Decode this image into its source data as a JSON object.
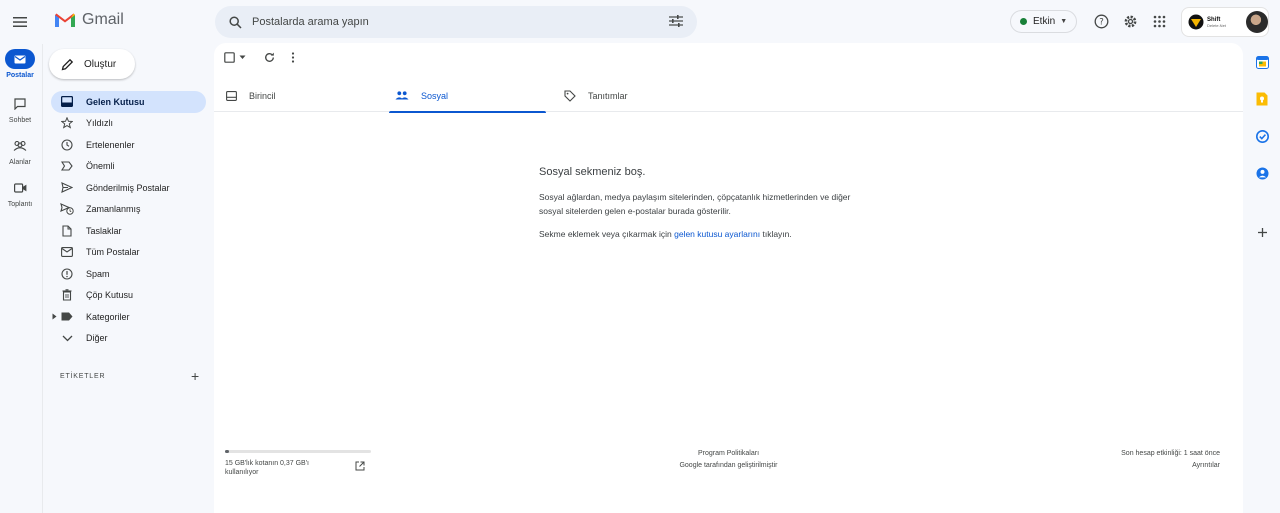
{
  "app": {
    "title": "Gmail"
  },
  "search": {
    "placeholder": "Postalarda arama yapın"
  },
  "status": {
    "label": "Etkin",
    "color": "#188038"
  },
  "account": {
    "brand_line1": "Shift",
    "brand_line2": "Delete.Net"
  },
  "rail": {
    "items": [
      {
        "label": "Postalar",
        "icon": "mail-icon",
        "active": true
      },
      {
        "label": "Sohbet",
        "icon": "chat-icon",
        "active": false
      },
      {
        "label": "Alanlar",
        "icon": "spaces-icon",
        "active": false
      },
      {
        "label": "Toplantı",
        "icon": "video-icon",
        "active": false
      }
    ]
  },
  "compose": {
    "label": "Oluştur"
  },
  "nav": {
    "items": [
      {
        "label": "Gelen Kutusu",
        "icon": "inbox-icon",
        "active": true
      },
      {
        "label": "Yıldızlı",
        "icon": "star-icon"
      },
      {
        "label": "Ertelenenler",
        "icon": "clock-icon"
      },
      {
        "label": "Önemli",
        "icon": "important-icon"
      },
      {
        "label": "Gönderilmiş Postalar",
        "icon": "send-icon"
      },
      {
        "label": "Zamanlanmış",
        "icon": "scheduled-icon"
      },
      {
        "label": "Taslaklar",
        "icon": "draft-icon"
      },
      {
        "label": "Tüm Postalar",
        "icon": "all-mail-icon"
      },
      {
        "label": "Spam",
        "icon": "spam-icon"
      },
      {
        "label": "Çöp Kutusu",
        "icon": "trash-icon"
      },
      {
        "label": "Kategoriler",
        "icon": "label-icon"
      },
      {
        "label": "Diğer",
        "icon": "chevron-down-icon"
      }
    ],
    "labels_heading": "ETİKETLER"
  },
  "tabs": [
    {
      "label": "Birincil",
      "icon": "inbox-tab-icon",
      "active": false
    },
    {
      "label": "Sosyal",
      "icon": "people-icon",
      "active": true
    },
    {
      "label": "Tanıtımlar",
      "icon": "tag-icon",
      "active": false
    }
  ],
  "empty_state": {
    "title": "Sosyal sekmeniz boş.",
    "line1": "Sosyal ağlardan, medya paylaşım sitelerinden, çöpçatanlık hizmetlerinden ve diğer",
    "line2": "sosyal sitelerden gelen e-postalar burada gösterilir.",
    "settings_prefix": "Sekme eklemek veya çıkarmak için ",
    "settings_link": "gelen kutusu ayarlarını",
    "settings_suffix": " tıklayın."
  },
  "footer": {
    "storage_text": "15 GB'lık kotanın 0,37 GB'ı kullanılıyor",
    "storage_used_fraction": 0.025,
    "program_policies": "Program Politikaları",
    "powered_by": "Google tarafından geliştirilmiştir",
    "last_activity": "Son hesap etkinliği: 1 saat önce",
    "details": "Ayrıntılar"
  },
  "colors": {
    "accent": "#0b57d0",
    "active_nav_bg": "#d3e3fd",
    "background": "#f6f8fc"
  }
}
